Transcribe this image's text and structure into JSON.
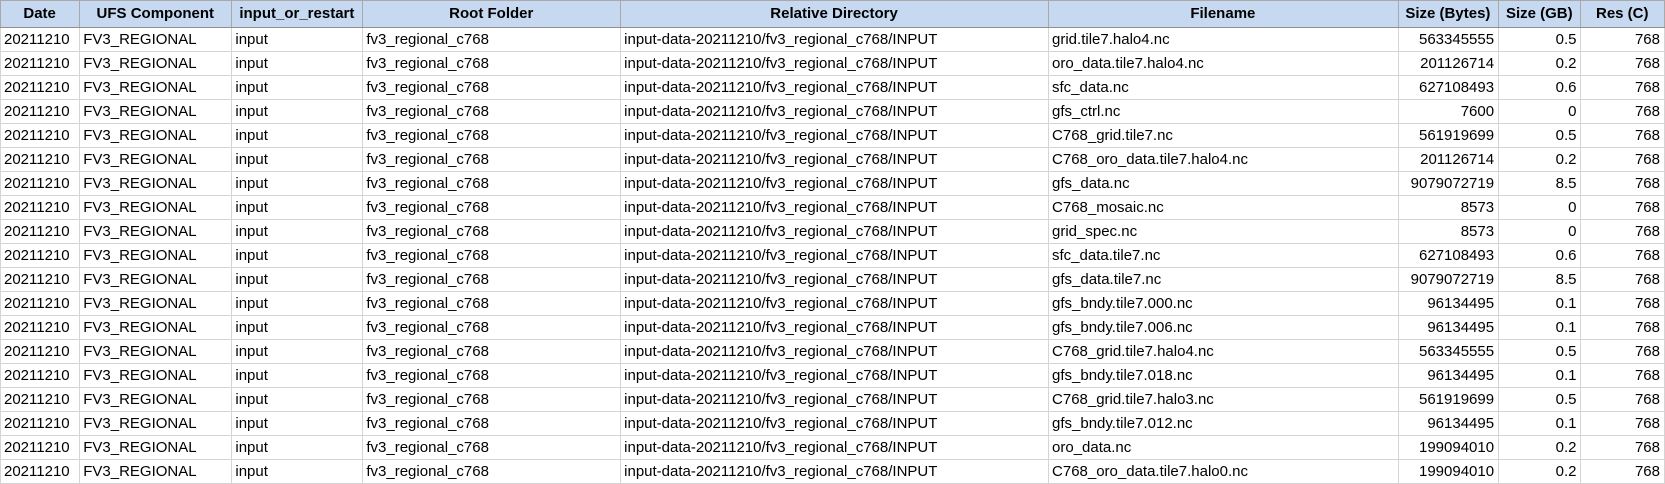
{
  "columns": [
    "Date",
    "UFS Component",
    "input_or_restart",
    "Root Folder",
    "Relative Directory",
    "Filename",
    "Size (Bytes)",
    "Size (GB)",
    "Res (C)"
  ],
  "rows": [
    [
      "20211210",
      "FV3_REGIONAL",
      "input",
      "fv3_regional_c768",
      "input-data-20211210/fv3_regional_c768/INPUT",
      "grid.tile7.halo4.nc",
      "563345555",
      "0.5",
      "768"
    ],
    [
      "20211210",
      "FV3_REGIONAL",
      "input",
      "fv3_regional_c768",
      "input-data-20211210/fv3_regional_c768/INPUT",
      "oro_data.tile7.halo4.nc",
      "201126714",
      "0.2",
      "768"
    ],
    [
      "20211210",
      "FV3_REGIONAL",
      "input",
      "fv3_regional_c768",
      "input-data-20211210/fv3_regional_c768/INPUT",
      "sfc_data.nc",
      "627108493",
      "0.6",
      "768"
    ],
    [
      "20211210",
      "FV3_REGIONAL",
      "input",
      "fv3_regional_c768",
      "input-data-20211210/fv3_regional_c768/INPUT",
      "gfs_ctrl.nc",
      "7600",
      "0",
      "768"
    ],
    [
      "20211210",
      "FV3_REGIONAL",
      "input",
      "fv3_regional_c768",
      "input-data-20211210/fv3_regional_c768/INPUT",
      "C768_grid.tile7.nc",
      "561919699",
      "0.5",
      "768"
    ],
    [
      "20211210",
      "FV3_REGIONAL",
      "input",
      "fv3_regional_c768",
      "input-data-20211210/fv3_regional_c768/INPUT",
      "C768_oro_data.tile7.halo4.nc",
      "201126714",
      "0.2",
      "768"
    ],
    [
      "20211210",
      "FV3_REGIONAL",
      "input",
      "fv3_regional_c768",
      "input-data-20211210/fv3_regional_c768/INPUT",
      "gfs_data.nc",
      "9079072719",
      "8.5",
      "768"
    ],
    [
      "20211210",
      "FV3_REGIONAL",
      "input",
      "fv3_regional_c768",
      "input-data-20211210/fv3_regional_c768/INPUT",
      "C768_mosaic.nc",
      "8573",
      "0",
      "768"
    ],
    [
      "20211210",
      "FV3_REGIONAL",
      "input",
      "fv3_regional_c768",
      "input-data-20211210/fv3_regional_c768/INPUT",
      "grid_spec.nc",
      "8573",
      "0",
      "768"
    ],
    [
      "20211210",
      "FV3_REGIONAL",
      "input",
      "fv3_regional_c768",
      "input-data-20211210/fv3_regional_c768/INPUT",
      "sfc_data.tile7.nc",
      "627108493",
      "0.6",
      "768"
    ],
    [
      "20211210",
      "FV3_REGIONAL",
      "input",
      "fv3_regional_c768",
      "input-data-20211210/fv3_regional_c768/INPUT",
      "gfs_data.tile7.nc",
      "9079072719",
      "8.5",
      "768"
    ],
    [
      "20211210",
      "FV3_REGIONAL",
      "input",
      "fv3_regional_c768",
      "input-data-20211210/fv3_regional_c768/INPUT",
      "gfs_bndy.tile7.000.nc",
      "96134495",
      "0.1",
      "768"
    ],
    [
      "20211210",
      "FV3_REGIONAL",
      "input",
      "fv3_regional_c768",
      "input-data-20211210/fv3_regional_c768/INPUT",
      "gfs_bndy.tile7.006.nc",
      "96134495",
      "0.1",
      "768"
    ],
    [
      "20211210",
      "FV3_REGIONAL",
      "input",
      "fv3_regional_c768",
      "input-data-20211210/fv3_regional_c768/INPUT",
      "C768_grid.tile7.halo4.nc",
      "563345555",
      "0.5",
      "768"
    ],
    [
      "20211210",
      "FV3_REGIONAL",
      "input",
      "fv3_regional_c768",
      "input-data-20211210/fv3_regional_c768/INPUT",
      "gfs_bndy.tile7.018.nc",
      "96134495",
      "0.1",
      "768"
    ],
    [
      "20211210",
      "FV3_REGIONAL",
      "input",
      "fv3_regional_c768",
      "input-data-20211210/fv3_regional_c768/INPUT",
      "C768_grid.tile7.halo3.nc",
      "561919699",
      "0.5",
      "768"
    ],
    [
      "20211210",
      "FV3_REGIONAL",
      "input",
      "fv3_regional_c768",
      "input-data-20211210/fv3_regional_c768/INPUT",
      "gfs_bndy.tile7.012.nc",
      "96134495",
      "0.1",
      "768"
    ],
    [
      "20211210",
      "FV3_REGIONAL",
      "input",
      "fv3_regional_c768",
      "input-data-20211210/fv3_regional_c768/INPUT",
      "oro_data.nc",
      "199094010",
      "0.2",
      "768"
    ],
    [
      "20211210",
      "FV3_REGIONAL",
      "input",
      "fv3_regional_c768",
      "input-data-20211210/fv3_regional_c768/INPUT",
      "C768_oro_data.tile7.halo0.nc",
      "199094010",
      "0.2",
      "768"
    ]
  ],
  "colors": {
    "header_background": "#c6d9f0",
    "grid_line": "#d4d4d4"
  }
}
